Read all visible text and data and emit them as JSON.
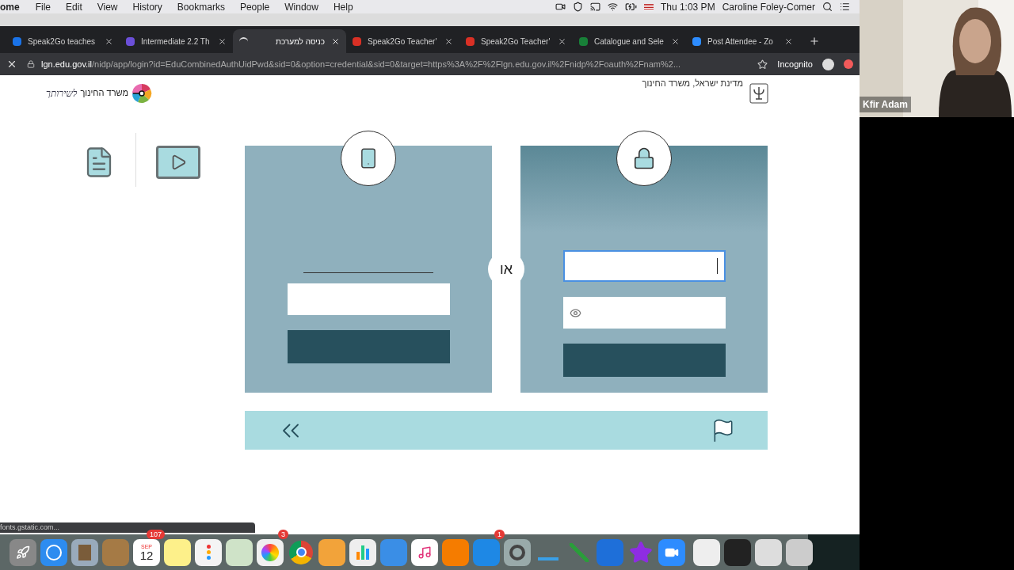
{
  "menu_bar": {
    "app_name": "ome",
    "items": [
      "File",
      "Edit",
      "View",
      "History",
      "Bookmarks",
      "People",
      "Window",
      "Help"
    ],
    "clock": "Thu 1:03 PM",
    "user": "Caroline Foley-Comer"
  },
  "tabs": [
    {
      "title": "Speak2Go teaches",
      "selected": false
    },
    {
      "title": "Intermediate 2.2 Th",
      "selected": false
    },
    {
      "title": "כניסה למערכת",
      "selected": true
    },
    {
      "title": "Speak2Go Teacher'",
      "selected": false
    },
    {
      "title": "Speak2Go Teacher'",
      "selected": false
    },
    {
      "title": "Catalogue and Sele",
      "selected": false
    },
    {
      "title": "Post Attendee - Zo",
      "selected": false
    }
  ],
  "address_bar": {
    "host": "lgn.edu.gov.il",
    "path": "/nidp/app/login?id=EduCombinedAuthUidPwd&sid=0&option=credential&sid=0&target=https%3A%2F%2Flgn.edu.gov.il%2Fnidp%2Foauth%2Fnam%2...",
    "incognito": "Incognito"
  },
  "page": {
    "logo_text": "משרד החינוך",
    "logo_script": "לשירותך",
    "state_title": "מדינת ישראל, משרד החינוך",
    "or_label": "או",
    "username_focused": true
  },
  "status_link": "fonts.gstatic.com...",
  "dock": {
    "calendar_month": "SEP",
    "calendar_day": "12",
    "calendar_badge": "107",
    "photos_badge": "3",
    "app_store_badge": "1"
  },
  "video": {
    "name": "Kfir Adam"
  }
}
